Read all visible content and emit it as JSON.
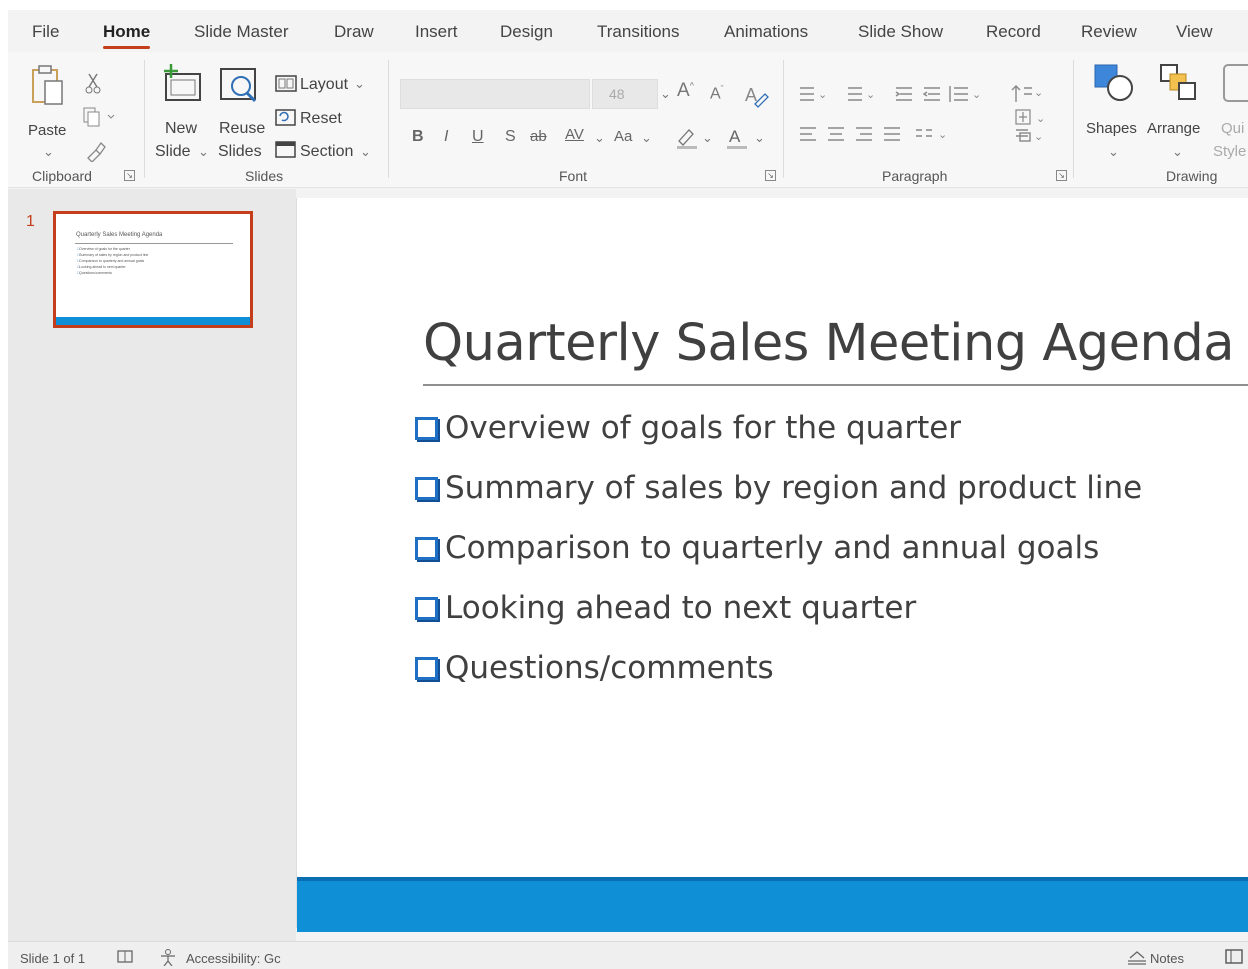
{
  "tabs": [
    "File",
    "Home",
    "Slide Master",
    "Draw",
    "Insert",
    "Design",
    "Transitions",
    "Animations",
    "Slide Show",
    "Record",
    "Review",
    "View"
  ],
  "ribbon": {
    "clipboard": {
      "paste_label": "Paste",
      "group_label": "Clipboard"
    },
    "slides": {
      "new_label": "New",
      "new_label2": "Slide",
      "reuse_label": "Reuse",
      "reuse_label2": "Slides",
      "layout_label": "Layout",
      "reset_label": "Reset",
      "section_label": "Section",
      "group_label": "Slides"
    },
    "font": {
      "size_value": "48",
      "group_label": "Font"
    },
    "paragraph": {
      "group_label": "Paragraph"
    },
    "drawing": {
      "shapes_label": "Shapes",
      "arrange_label": "Arrange",
      "quick_label": "Qui",
      "styles_label": "Style",
      "group_label": "Drawing"
    }
  },
  "thumbnail": {
    "number": "1",
    "title": "Quarterly Sales Meeting Agenda",
    "bullets": [
      "Overview of goals for the quarter",
      "Summary of sales by region and product line",
      "Comparison to quarterly and annual goals",
      "Looking ahead to next quarter",
      "Questions/comments"
    ]
  },
  "slide": {
    "title": "Quarterly Sales Meeting Agenda",
    "bullets": [
      "Overview of goals for the quarter",
      "Summary of sales by region and product line",
      "Comparison to quarterly and annual goals",
      "Looking ahead to next quarter",
      "Questions/comments"
    ],
    "accent_color": "#0e8fd6",
    "bullet_color": "#1f6fc5"
  },
  "status": {
    "slide_info": "Slide 1 of 1",
    "accessibility": "Accessibility: Gc",
    "notes": "Notes"
  },
  "colors": {
    "accent_tab": "#c43e1c"
  }
}
